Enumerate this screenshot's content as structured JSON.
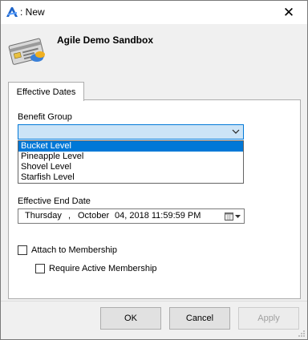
{
  "window": {
    "title": ": New"
  },
  "header": {
    "title": "Agile Demo Sandbox"
  },
  "tabs": [
    {
      "label": "Effective Dates"
    }
  ],
  "benefit_group": {
    "label": "Benefit Group",
    "value": "",
    "options": [
      "Bucket Level",
      "Pineapple Level",
      "Shovel Level",
      "Starfish Level"
    ],
    "selected_index": 0
  },
  "effective_end_date": {
    "label": "Effective End Date",
    "weekday": "Thursday",
    "sep": ",",
    "month": "October",
    "day_year_time": "04, 2018 11:59:59 PM"
  },
  "checkboxes": {
    "attach": {
      "label": "Attach to Membership",
      "checked": false
    },
    "require_active": {
      "label": "Require Active Membership",
      "checked": false
    }
  },
  "buttons": {
    "ok": "OK",
    "cancel": "Cancel",
    "apply": "Apply"
  },
  "colors": {
    "accent": "#0078d7",
    "combo_bg": "#cce4f7",
    "selected_text": "#ffffff"
  }
}
